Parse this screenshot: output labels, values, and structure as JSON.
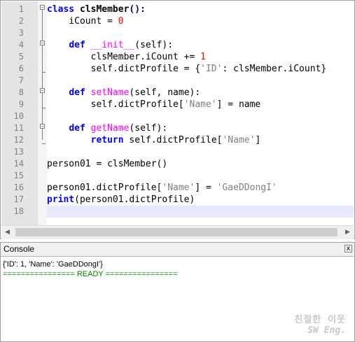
{
  "editor": {
    "lines": [
      {
        "n": "1"
      },
      {
        "n": "2"
      },
      {
        "n": "3"
      },
      {
        "n": "4"
      },
      {
        "n": "5"
      },
      {
        "n": "6"
      },
      {
        "n": "7"
      },
      {
        "n": "8"
      },
      {
        "n": "9"
      },
      {
        "n": "10"
      },
      {
        "n": "11"
      },
      {
        "n": "12"
      },
      {
        "n": "13"
      },
      {
        "n": "14"
      },
      {
        "n": "15"
      },
      {
        "n": "16"
      },
      {
        "n": "17"
      },
      {
        "n": "18"
      }
    ],
    "code": {
      "l1_kw": "class",
      "l1_name": " clsMember",
      "l1_rest": "():",
      "l2_pre": "    iCount = ",
      "l2_num": "0",
      "l4_pre": "    ",
      "l4_kw": "def",
      "l4_sp": " ",
      "l4_fn": "__init__",
      "l4_rest": "(self):",
      "l5_pre": "        clsMember.iCount += ",
      "l5_num": "1",
      "l6_pre": "        self.dictProfile = {",
      "l6_str": "'ID'",
      "l6_rest": ": clsMember.iCount}",
      "l8_pre": "    ",
      "l8_kw": "def",
      "l8_sp": " ",
      "l8_fn": "setName",
      "l8_rest": "(self, name):",
      "l9_pre": "        self.dictProfile[",
      "l9_str": "'Name'",
      "l9_rest": "] = name",
      "l11_pre": "    ",
      "l11_kw": "def",
      "l11_sp": " ",
      "l11_fn": "getName",
      "l11_rest": "(self):",
      "l12_pre": "        ",
      "l12_kw": "return",
      "l12_mid": " self.dictProfile[",
      "l12_str": "'Name'",
      "l12_rest": "]",
      "l14": "person01 = clsMember()",
      "l16_pre": "person01.dictProfile[",
      "l16_str": "'Name'",
      "l16_mid": "] = ",
      "l16_str2": "'GaeDDongI'",
      "l17_kw": "print",
      "l17_rest": "(person01.dictProfile)"
    }
  },
  "console": {
    "title": "Console",
    "close": "x",
    "output": [
      "{'ID': 1, 'Name': 'GaeDDongI'}",
      "================ READY ================"
    ]
  },
  "watermark": {
    "line1": "친절한 이웃",
    "line2": "SW Eng."
  },
  "scrollbar": {
    "left_arrow": "◀",
    "right_arrow": "▶"
  },
  "colors": {
    "keyword": "#0000ff",
    "function": "#ff00ff",
    "number": "#ff0000",
    "string": "#808080",
    "ready": "#008000",
    "current_line": "#e8e8ff"
  }
}
